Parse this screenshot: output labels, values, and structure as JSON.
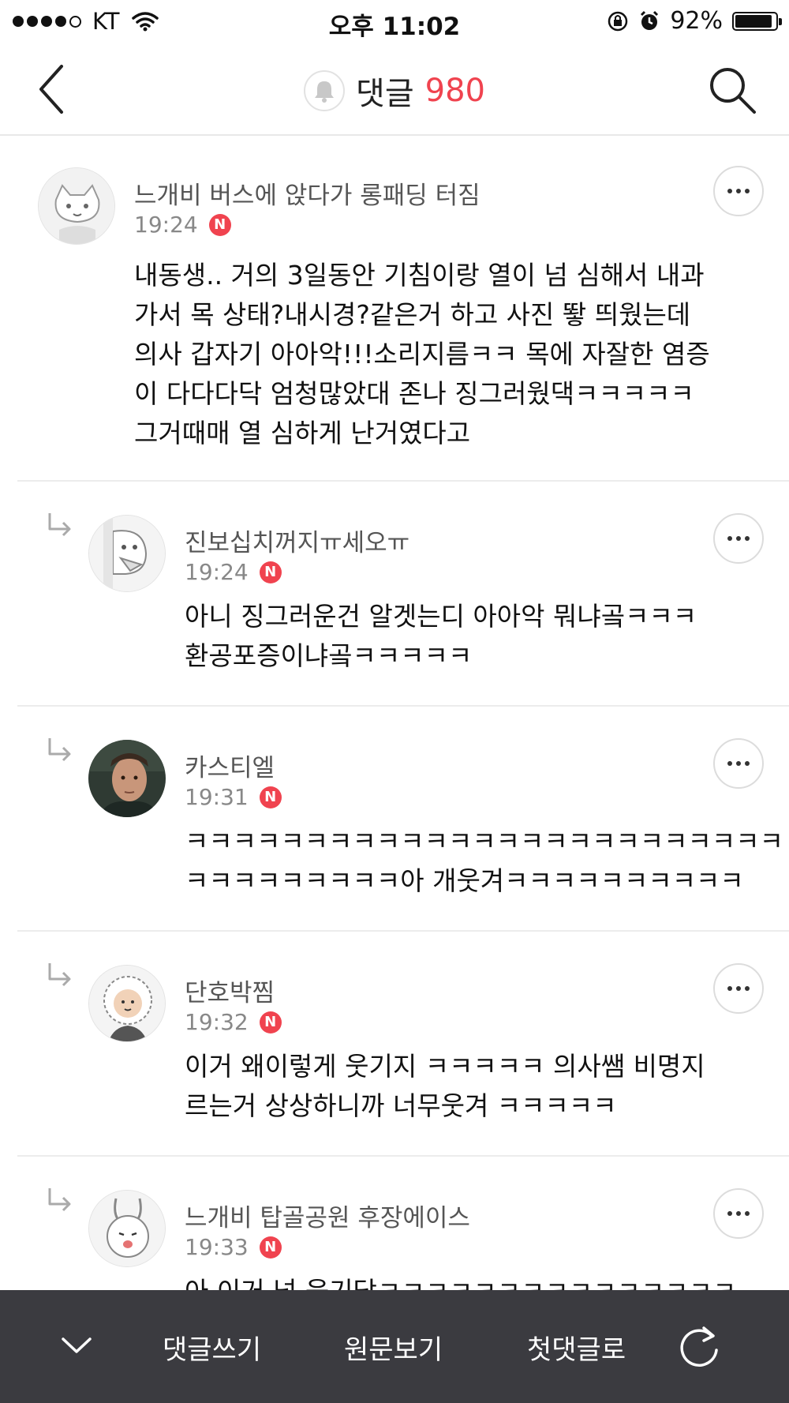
{
  "status_bar": {
    "carrier": "KT",
    "time": "오후 11:02",
    "battery": "92%",
    "battery_level": 0.92
  },
  "nav": {
    "title": "댓글",
    "count": "980"
  },
  "comments": [
    {
      "author": "느개비 버스에 앉다가 롱패딩 터짐",
      "time": "19:24",
      "badge": "N",
      "reply": false,
      "lines": [
        "내동생.. 거의 3일동안 기침이랑 열이 넘 심해서 내과",
        "가서 목 상태?내시경?같은거 하고 사진 뙇 띄웠는데",
        "의사 갑자기 아아악!!!소리지름ㅋㅋ 목에 자잘한 염증",
        "이 다다다닥 엄청많았대 존나 징그러웠댁ㅋㅋㅋㅋㅋ",
        "그거때매 열 심하게 난거였다고"
      ]
    },
    {
      "author": "진보십치꺼지ㅠ세오ㅠ",
      "time": "19:24",
      "badge": "N",
      "reply": true,
      "lines": [
        "아니 징그러운건 알겟는디 아아악 뭐냐곸ㅋㅋㅋ",
        "환공포증이냐곸ㅋㅋㅋㅋㅋ"
      ]
    },
    {
      "author": "카스티엘",
      "time": "19:31",
      "badge": "N",
      "reply": true,
      "lines": [
        "ㅋㅋㅋㅋㅋㅋㅋㅋㅋㅋㅋㅋㅋㅋㅋㅋㅋㅋㅋㅋㅋㅋㅋㅋㅋ",
        "ㅋㅋㅋㅋㅋㅋㅋㅋㅋ아 개웃겨ㅋㅋㅋㅋㅋㅋㅋㅋㅋㅋ"
      ]
    },
    {
      "author": "단호박찜",
      "time": "19:32",
      "badge": "N",
      "reply": true,
      "lines": [
        "이거 왜이렇게 웃기지 ㅋㅋㅋㅋㅋ 의사쌤 비명지",
        "르는거 상상하니까 너무웃겨 ㅋㅋㅋㅋㅋ"
      ]
    },
    {
      "author": "느개비 탑골공원 후장에이스",
      "time": "19:33",
      "badge": "N",
      "reply": true,
      "lines": [
        "아 이거 넘 웃기닼ㅋㅋㅋㅋㅋㅋㅋㅋㅋㅋㅋㅋㅋㅋㅋ"
      ]
    }
  ],
  "bottom_bar": {
    "write": "댓글쓰기",
    "original": "원문보기",
    "first": "첫댓글로"
  },
  "colors": {
    "accent": "#f0434f",
    "bottom_bar": "#3b3b40"
  }
}
